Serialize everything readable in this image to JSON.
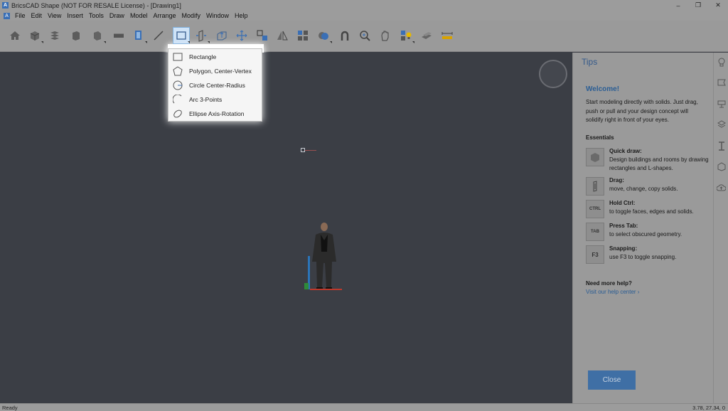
{
  "window": {
    "title": "BricsCAD Shape (NOT FOR RESALE License) - [Drawing1]",
    "logo": "A",
    "controls": [
      "–",
      "❐",
      "✕"
    ]
  },
  "menubar": {
    "logo": "A",
    "items": [
      "File",
      "Edit",
      "View",
      "Insert",
      "Tools",
      "Draw",
      "Model",
      "Arrange",
      "Modify",
      "Window",
      "Help"
    ]
  },
  "toolbar": {
    "active_tool_icon": "rectangle-draw-icon"
  },
  "draw_menu": {
    "items": [
      {
        "label": "Rectangle",
        "icon": "rectangle-icon"
      },
      {
        "label": "Polygon, Center-Vertex",
        "icon": "polygon-icon"
      },
      {
        "label": "Circle Center-Radius",
        "icon": "circle-icon"
      },
      {
        "label": "Arc 3-Points",
        "icon": "arc-icon"
      },
      {
        "label": "Ellipse Axis-Rotation",
        "icon": "ellipse-icon"
      }
    ]
  },
  "tips": {
    "title": "Tips",
    "welcome": "Welcome!",
    "intro": "Start modeling directly with solids. Just drag, push or pull and your design concept will solidify right in front of your eyes.",
    "essentials": "Essentials",
    "items": [
      {
        "icon": "",
        "head": "Quick draw:",
        "body": "Design buildings and rooms by drawing rectangles and L-shapes."
      },
      {
        "icon": "",
        "head": "Drag:",
        "body": "move, change, copy solids."
      },
      {
        "icon": "CTRL",
        "head": "Hold Ctrl:",
        "body": "to toggle faces, edges and solids."
      },
      {
        "icon": "TAB",
        "head": "Press Tab:",
        "body": "to select obscured geometry."
      },
      {
        "icon": "F3",
        "head": "Snapping:",
        "body": "use F3 to toggle snapping."
      }
    ],
    "help_head": "Need more help?",
    "help_link": "Visit our help center ›",
    "close": "Close"
  },
  "status": {
    "left": "Ready",
    "coords": "3.78, 27.34, 0"
  },
  "colors": {
    "viewport": "#3b3e45",
    "panel": "#9a9a9a",
    "accent": "#3f6fa5",
    "axis_x": "#c0392b",
    "axis_y": "#2b74b8",
    "axis_z": "#2e8b3a"
  }
}
